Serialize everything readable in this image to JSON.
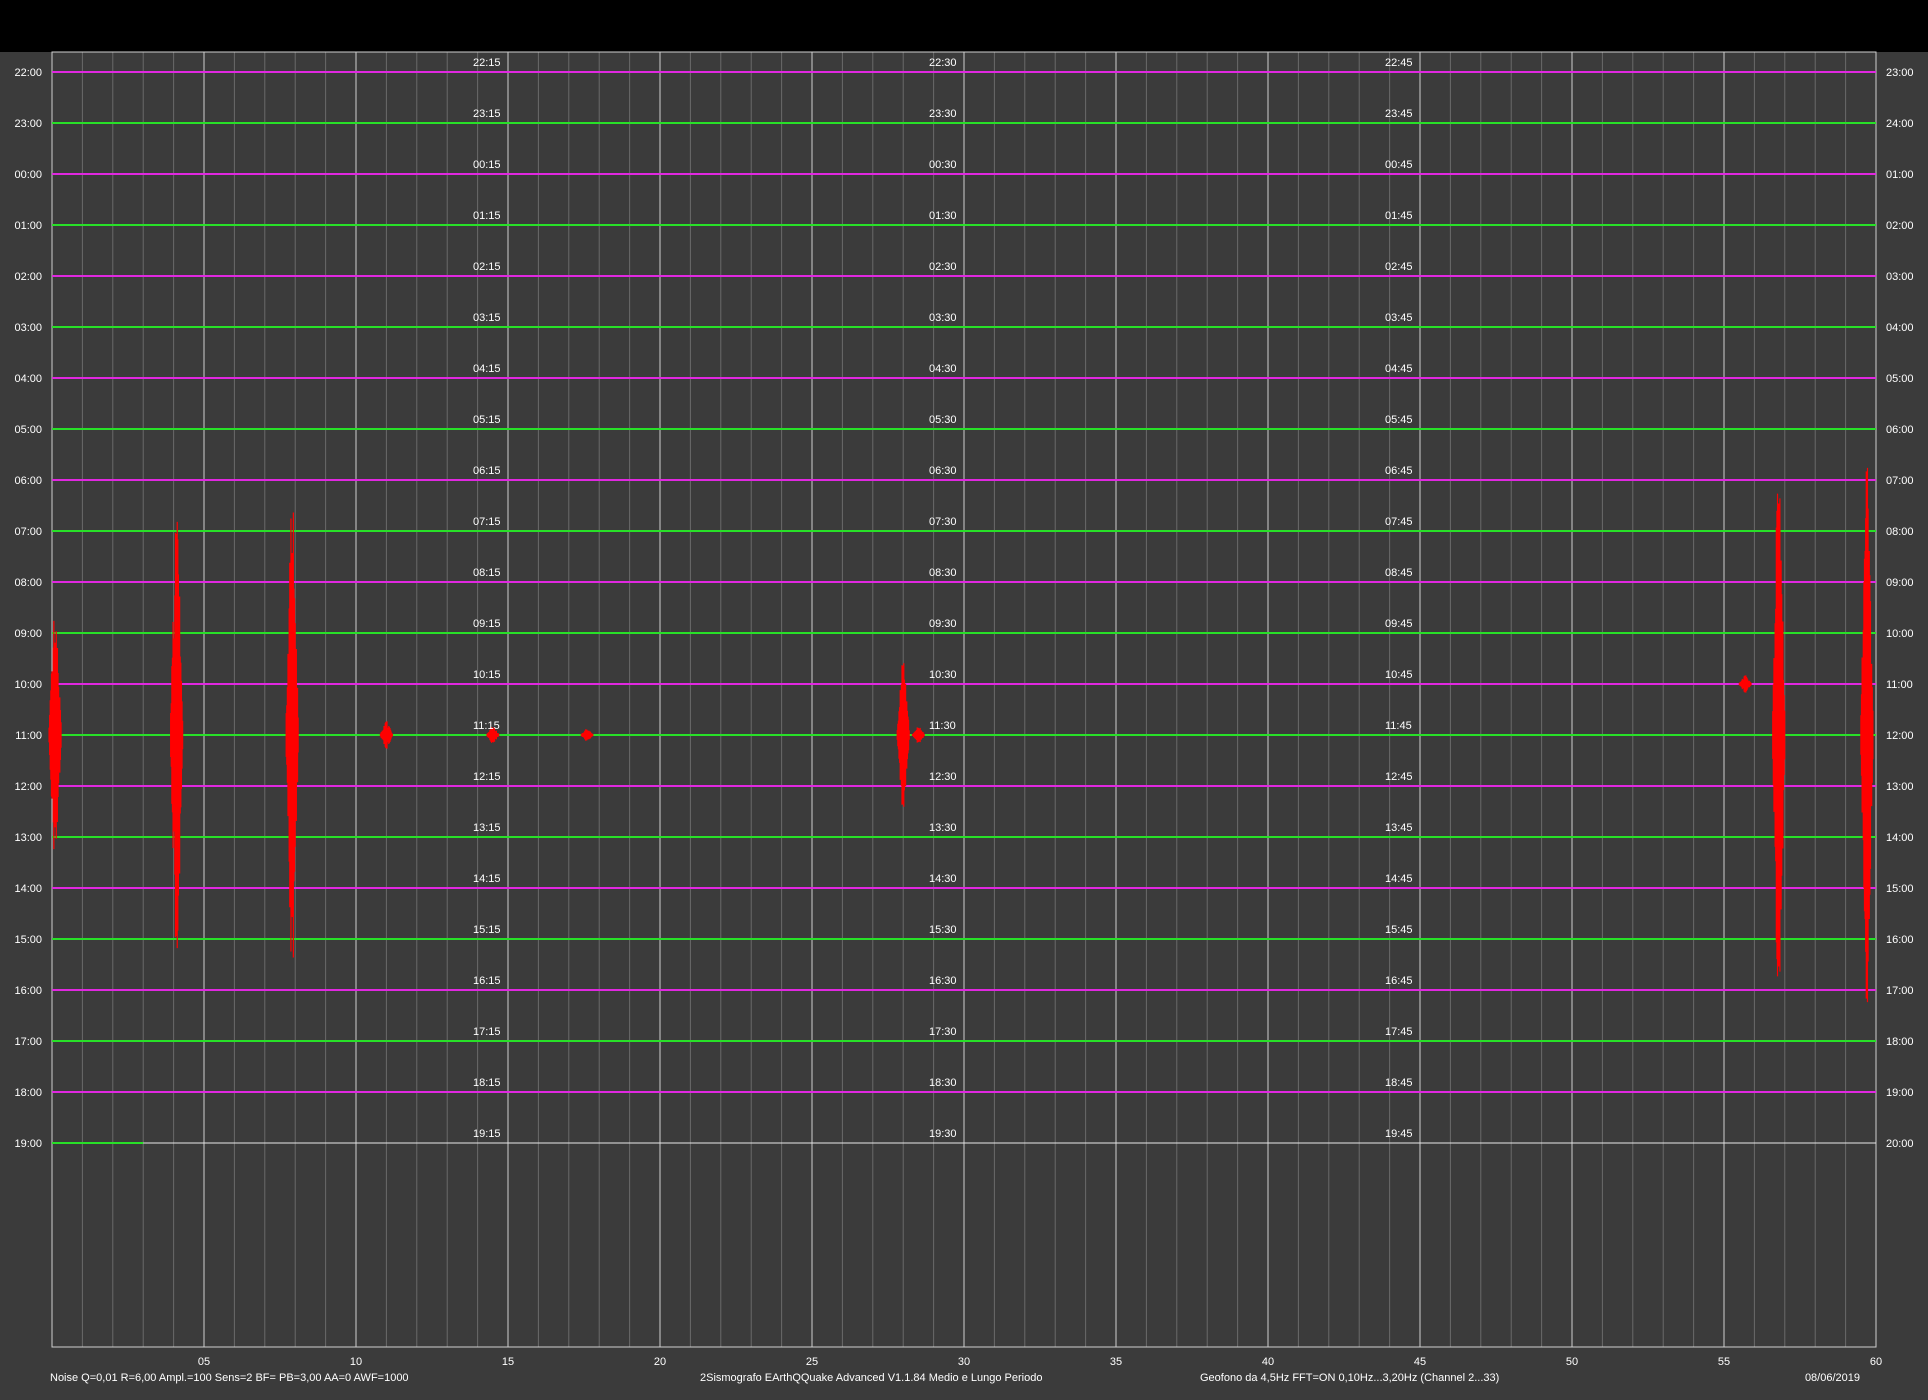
{
  "chart_data": {
    "type": "line",
    "title": "",
    "x_axis": {
      "range": [
        0,
        60
      ],
      "ticks": [
        "05",
        "10",
        "15",
        "20",
        "25",
        "30",
        "35",
        "40",
        "45",
        "50",
        "55",
        "60"
      ],
      "tick_values": [
        5,
        10,
        15,
        20,
        25,
        30,
        35,
        40,
        45,
        50,
        55,
        60
      ],
      "minor_step": 1,
      "grid": true
    },
    "rows": {
      "left_labels": [
        "22:00",
        "23:00",
        "00:00",
        "01:00",
        "02:00",
        "03:00",
        "04:00",
        "05:00",
        "06:00",
        "07:00",
        "08:00",
        "09:00",
        "10:00",
        "11:00",
        "12:00",
        "13:00",
        "14:00",
        "15:00",
        "16:00",
        "17:00",
        "18:00",
        "19:00"
      ],
      "right_labels": [
        "23:00",
        "24:00",
        "01:00",
        "02:00",
        "03:00",
        "04:00",
        "05:00",
        "06:00",
        "07:00",
        "08:00",
        "09:00",
        "10:00",
        "11:00",
        "12:00",
        "13:00",
        "14:00",
        "15:00",
        "16:00",
        "17:00",
        "18:00",
        "19:00",
        "20:00"
      ],
      "quarter_15": [
        "22:15",
        "23:15",
        "00:15",
        "01:15",
        "02:15",
        "03:15",
        "04:15",
        "05:15",
        "06:15",
        "07:15",
        "08:15",
        "09:15",
        "10:15",
        "11:15",
        "12:15",
        "13:15",
        "14:15",
        "15:15",
        "16:15",
        "17:15",
        "18:15",
        "19:15"
      ],
      "quarter_30": [
        "22:30",
        "23:30",
        "00:30",
        "01:30",
        "02:30",
        "03:30",
        "04:30",
        "05:30",
        "06:30",
        "07:30",
        "08:30",
        "09:30",
        "10:30",
        "11:30",
        "12:30",
        "13:30",
        "14:30",
        "15:30",
        "16:30",
        "17:30",
        "18:30",
        "19:30"
      ],
      "quarter_45": [
        "22:45",
        "23:45",
        "00:45",
        "01:45",
        "02:45",
        "03:45",
        "04:45",
        "05:45",
        "06:45",
        "07:45",
        "08:45",
        "09:45",
        "10:45",
        "11:45",
        "12:45",
        "13:45",
        "14:45",
        "15:45",
        "16:45",
        "17:45",
        "18:45",
        "19:45"
      ],
      "trace_colors": [
        "#e028e0",
        "#28e028"
      ],
      "current_row": 21,
      "current_minute": 3
    },
    "events": [
      {
        "row": 13,
        "minute": 0.1,
        "amplitude": 2.8
      },
      {
        "row": 13,
        "minute": 4.1,
        "amplitude": 5.0
      },
      {
        "row": 13,
        "minute": 7.9,
        "amplitude": 5.4
      },
      {
        "row": 13,
        "minute": 11.0,
        "amplitude": 0.3
      },
      {
        "row": 13,
        "minute": 14.5,
        "amplitude": 0.2
      },
      {
        "row": 13,
        "minute": 17.6,
        "amplitude": 0.15
      },
      {
        "row": 13,
        "minute": 28.0,
        "amplitude": 1.8
      },
      {
        "row": 13,
        "minute": 28.5,
        "amplitude": 0.2
      },
      {
        "row": 12,
        "minute": 55.7,
        "amplitude": 0.2
      },
      {
        "row": 13,
        "minute": 56.8,
        "amplitude": 6.4
      },
      {
        "row": 13,
        "minute": 59.7,
        "amplitude": 5.8
      }
    ],
    "trace_color": "#ff0000",
    "event_color": "#ff0000"
  },
  "footer": {
    "left": "Noise Q=0,01 R=6,00 Ampl.=100 Sens=2 BF= PB=3,00 AA=0 AWF=1000",
    "center": "2Sismografo  EArthQQuake Advanced V1.1.84  Medio e Lungo Periodo",
    "right": "Geofono da 4,5Hz FFT=ON 0,10Hz...3,20Hz      (Channel 2...33)",
    "date": "08/06/2019"
  },
  "colors": {
    "background": "#3b3b3b",
    "topbar": "#000000",
    "grid_major": "#cfcfcf",
    "grid_minor": "#6a6a6a",
    "text": "#ffffff"
  }
}
